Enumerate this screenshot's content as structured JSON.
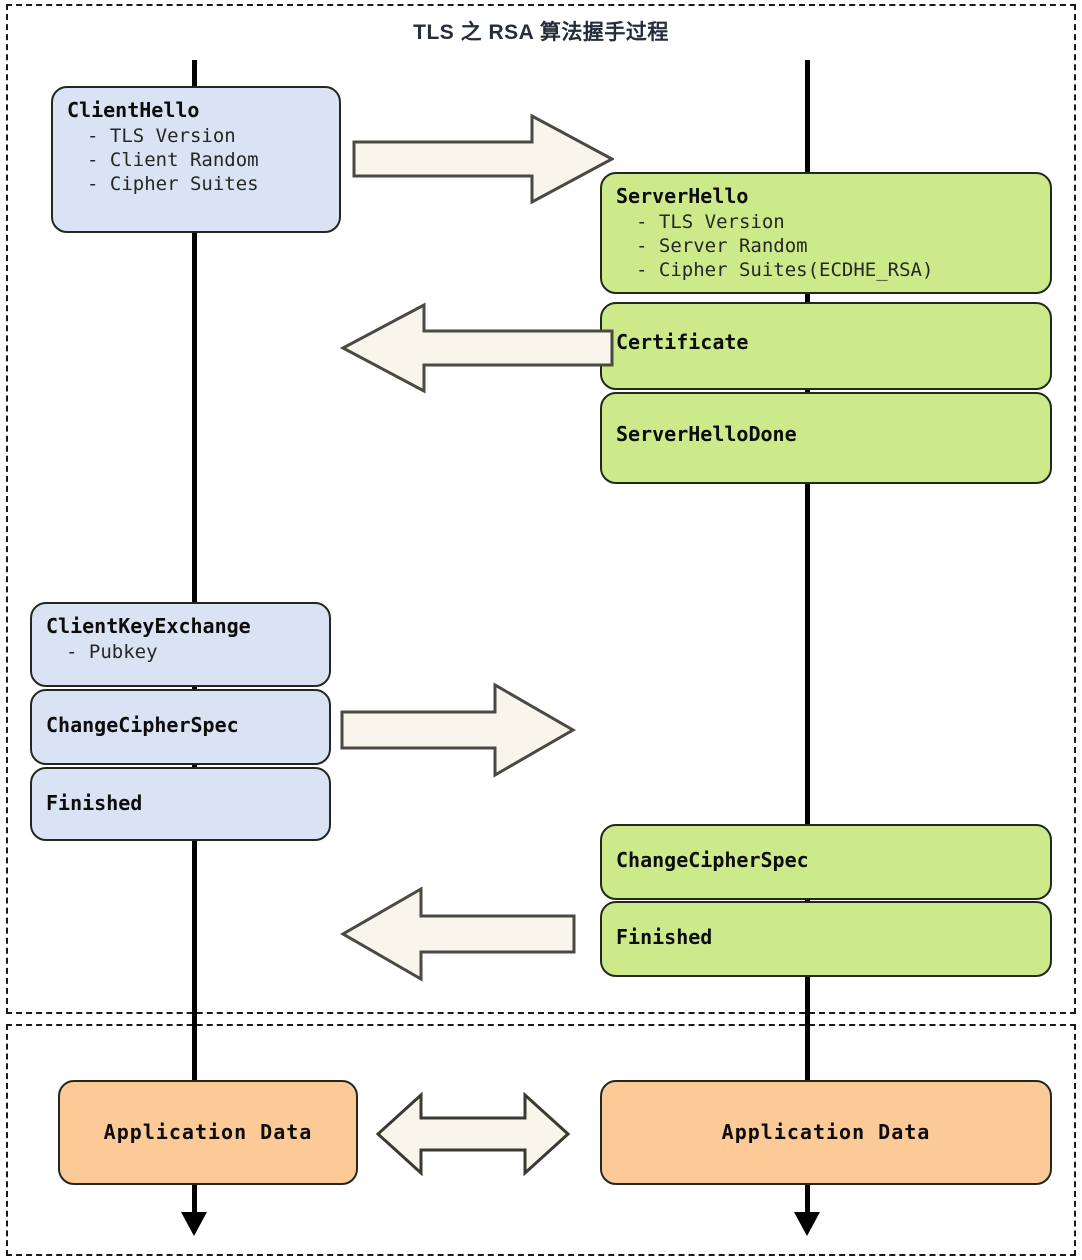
{
  "title": "TLS 之 RSA 算法握手过程",
  "colors": {
    "client_fill": "#dae3f3",
    "server_fill": "#cdea8b",
    "app_fill": "#fcca97",
    "arrow_fill": "#f7f5ec",
    "arrow_stroke": "#4a4a42",
    "box_stroke": "#23281f",
    "lifeline": "#000000",
    "title_text": "#262d3d"
  },
  "phases": {
    "handshake_label": "",
    "application_label": ""
  },
  "lifelines": {
    "client": "client-lifeline",
    "server": "server-lifeline"
  },
  "client": {
    "hello": {
      "title": "ClientHello",
      "bullets": [
        "- TLS Version",
        "- Client Random",
        "- Cipher Suites"
      ]
    },
    "key_exchange": {
      "title": "ClientKeyExchange",
      "bullets": [
        "- Pubkey"
      ]
    },
    "change_cipher_spec": {
      "title": "ChangeCipherSpec"
    },
    "finished": {
      "title": "Finished"
    },
    "app_data": {
      "title": "Application Data"
    }
  },
  "server": {
    "hello": {
      "title": "ServerHello",
      "bullets": [
        "- TLS Version",
        "- Server Random",
        "- Cipher Suites(ECDHE_RSA)"
      ]
    },
    "certificate": {
      "title": "Certificate"
    },
    "hello_done": {
      "title": "ServerHelloDone"
    },
    "change_cipher_spec": {
      "title": "ChangeCipherSpec"
    },
    "finished": {
      "title": "Finished"
    },
    "app_data": {
      "title": "Application Data"
    }
  },
  "arrows": [
    {
      "name": "client-hello-arrow",
      "direction": "right"
    },
    {
      "name": "server-hello-arrow",
      "direction": "left"
    },
    {
      "name": "client-key-exchange-arrow",
      "direction": "right"
    },
    {
      "name": "server-finished-arrow",
      "direction": "left"
    },
    {
      "name": "application-data-arrow",
      "direction": "both"
    }
  ]
}
